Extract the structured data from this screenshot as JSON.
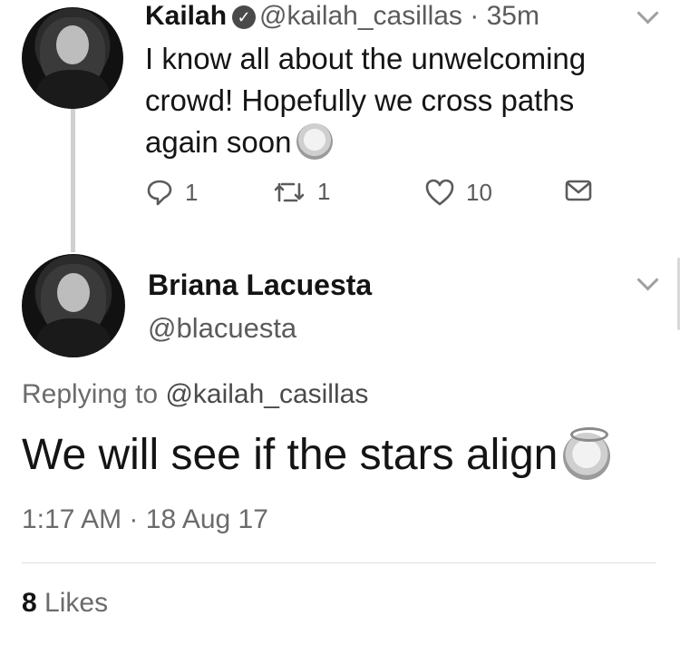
{
  "tweet_parent": {
    "author_name": "Kailah",
    "verified": true,
    "handle": "@kailah_casillas",
    "separator": "·",
    "time_ago": "35m",
    "text": "I know all about the unwelcoming crowd! Hopefully we cross paths again soon",
    "emoji": "hugging-face-emoji",
    "actions": {
      "reply_count": "1",
      "retweet_count": "1",
      "like_count": "10"
    }
  },
  "tweet_main": {
    "author_name": "Briana Lacuesta",
    "handle": "@blacuesta",
    "replying_prefix": "Replying to",
    "replying_to": "@kailah_casillas",
    "text": "We will see if the stars align",
    "emoji": "angel-face-emoji",
    "time": "1:17 AM",
    "separator": "·",
    "date": "18 Aug 17",
    "likes_count": "8",
    "likes_label": "Likes"
  },
  "icons": [
    "reply-icon",
    "retweet-icon",
    "like-icon",
    "direct-message-icon",
    "verified-icon",
    "chevron-down-icon"
  ],
  "colors": {
    "text": "#141414",
    "secondary": "#5b5b5b",
    "thread_line": "#cfcfcf"
  }
}
